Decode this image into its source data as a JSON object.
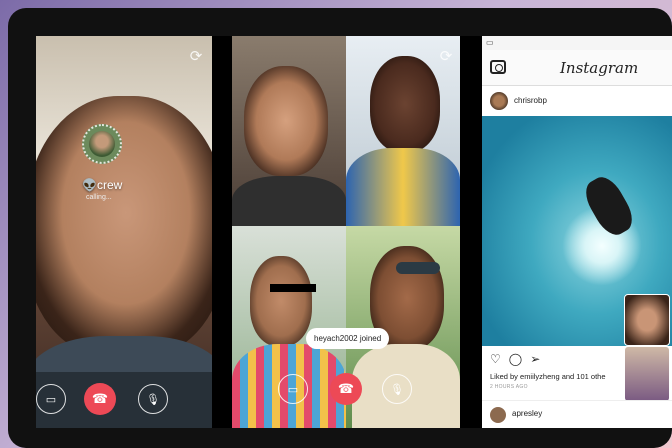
{
  "phone1": {
    "caller_name": "crew",
    "caller_prefix": "👽",
    "call_status": "calling..."
  },
  "phone2": {
    "join_toast": "heyach2002 joined"
  },
  "instagram": {
    "logo": "Instagram",
    "post_username": "chrisrobp",
    "likes": "Liked by emiilyzheng and 101 othe",
    "timestamp": "2 HOURS AGO",
    "next_username": "apresley"
  },
  "colors": {
    "end_call": "#ed4956",
    "background": "#7c6ba8"
  },
  "icons": [
    "flip-camera-icon",
    "video-icon",
    "end-call-icon",
    "mic-icon",
    "camera-icon",
    "heart-icon",
    "comment-icon",
    "share-icon"
  ]
}
